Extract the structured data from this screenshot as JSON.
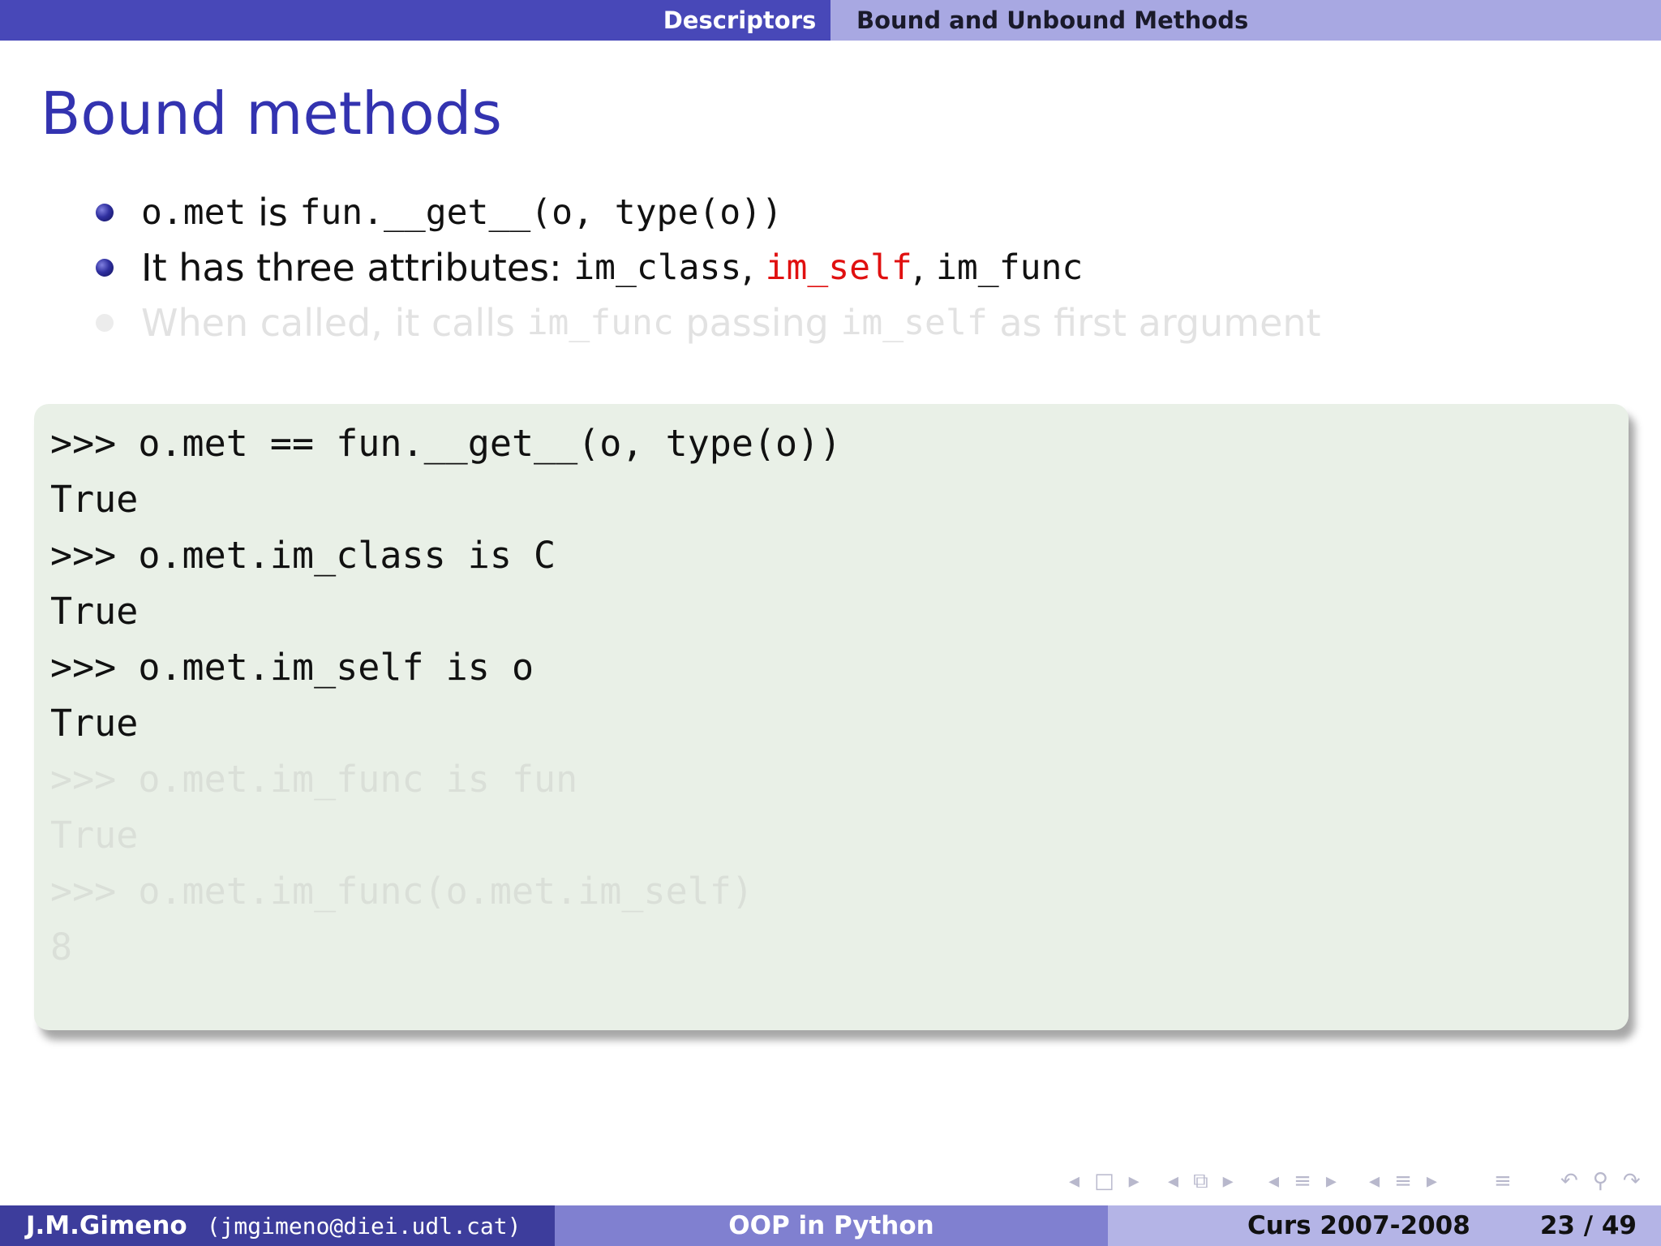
{
  "header": {
    "section": "Descriptors",
    "subsection": "Bound and Unbound Methods"
  },
  "slide": {
    "title": "Bound methods",
    "bullets": {
      "b1": {
        "code1": "o.met",
        "text1": " is ",
        "code2": "fun.__get__(o, type(o))"
      },
      "b2": {
        "text1": "It has three attributes: ",
        "attr1": "im_class",
        "sep1": ", ",
        "attr2": "im_self",
        "sep2": ", ",
        "attr3": "im_func"
      },
      "b3": {
        "text1": "When called, it calls ",
        "code1": "im_func",
        "text2": " passing ",
        "code2": "im_self",
        "text3": " as first argument"
      }
    },
    "code_lines": [
      ">>> o.met == fun.__get__(o, type(o))",
      "True",
      ">>> o.met.im_class is C",
      "True",
      ">>> o.met.im_self is o",
      "True",
      ">>> o.met.im_func is fun",
      "True",
      ">>> o.met.im_func(o.met.im_self)",
      "8"
    ]
  },
  "nav_icons": [
    "nav-frame-prev-icon",
    "nav-frame-icon",
    "nav-frame-next-icon",
    "nav-subsection-prev-icon",
    "nav-subsection-icon",
    "nav-subsection-next-icon",
    "nav-section-prev-icon",
    "nav-section-icon",
    "nav-section-next-icon",
    "nav-slide-prev-icon",
    "nav-slide-icon",
    "nav-slide-next-icon",
    "nav-align-icon",
    "nav-undo-icon",
    "nav-search-icon",
    "nav-redo-icon"
  ],
  "footer": {
    "author": "J.M.Gimeno",
    "email": "(jmgimeno@diei.udl.cat)",
    "title": "OOP in Python",
    "course": "Curs 2007-2008",
    "page": "23 / 49"
  },
  "colors": {
    "accent": "#4848b8",
    "title": "#3333b0",
    "highlight": "#e01010",
    "code_background": "#e9f0e7"
  }
}
